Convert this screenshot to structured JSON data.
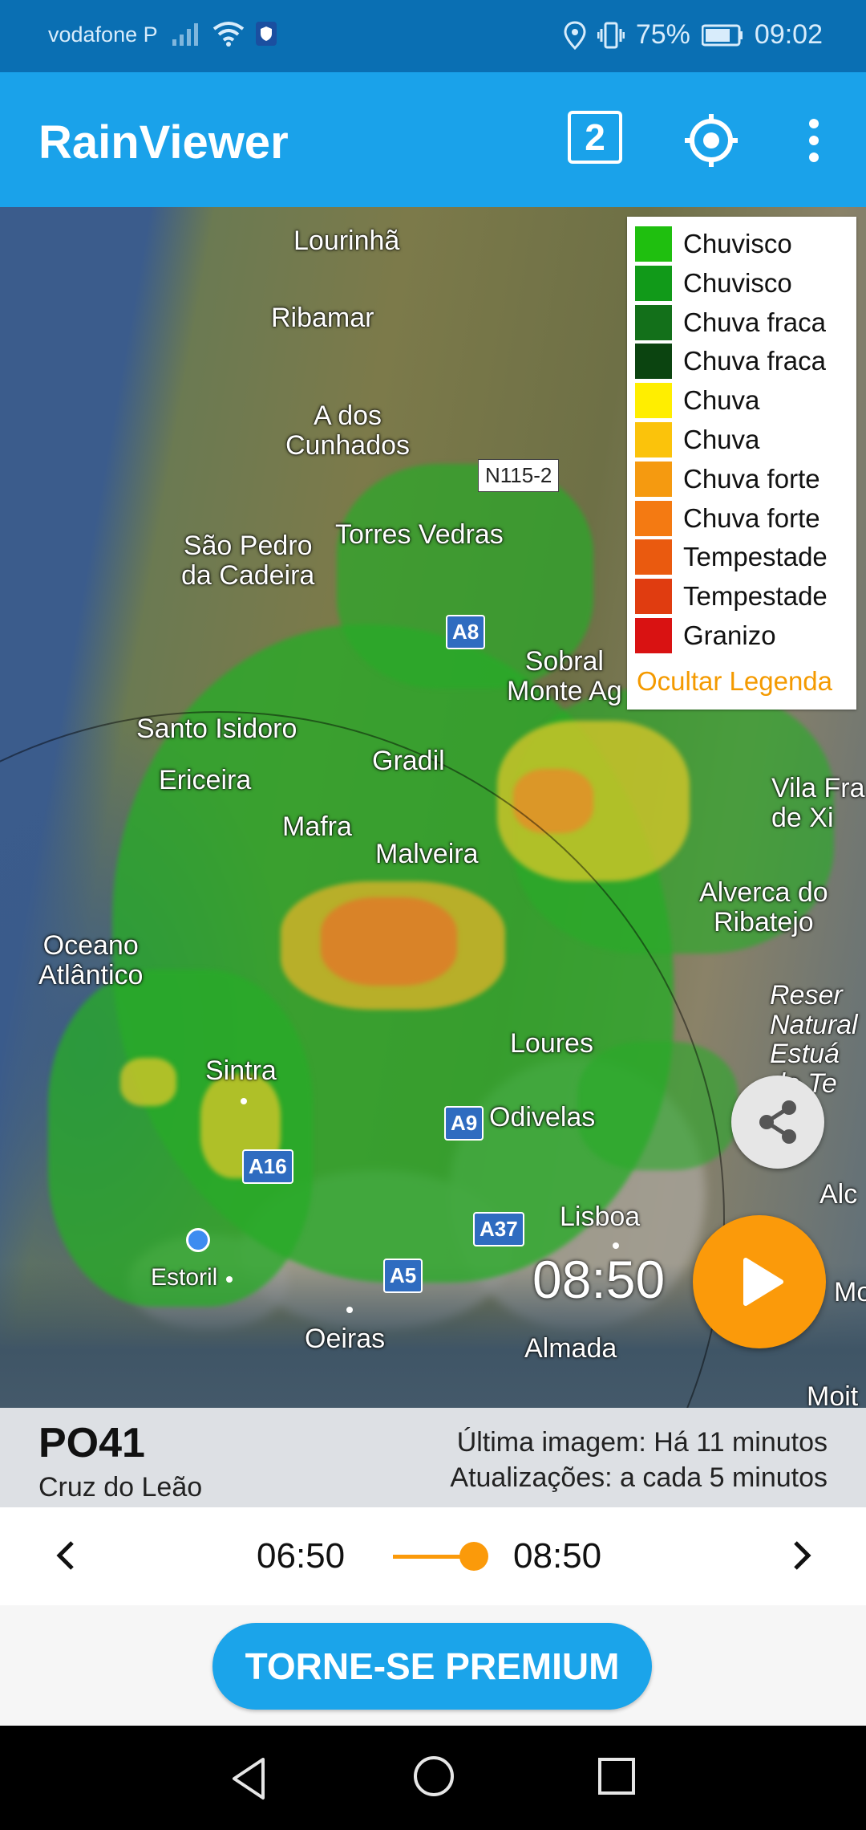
{
  "status_bar": {
    "carrier": "vodafone P",
    "battery": "75%",
    "time": "09:02",
    "icons": [
      "signal-icon",
      "wifi-icon",
      "shield-icon",
      "location-icon",
      "vibrate-icon",
      "battery-icon"
    ]
  },
  "app_bar": {
    "title": "RainViewer",
    "radar_count": "2",
    "icons": [
      "locate-icon",
      "more-vert-icon"
    ]
  },
  "legend": {
    "items": [
      {
        "label": "Chuvisco",
        "color": "#1fbf0f"
      },
      {
        "label": "Chuvisco",
        "color": "#119a19"
      },
      {
        "label": "Chuva fraca",
        "color": "#13701a"
      },
      {
        "label": "Chuva fraca",
        "color": "#0b4410"
      },
      {
        "label": "Chuva",
        "color": "#ffee00"
      },
      {
        "label": "Chuva",
        "color": "#fbc30b"
      },
      {
        "label": "Chuva forte",
        "color": "#f59a10"
      },
      {
        "label": "Chuva forte",
        "color": "#f47a12"
      },
      {
        "label": "Tempestade",
        "color": "#ea5a0f"
      },
      {
        "label": "Tempestade",
        "color": "#e03c10"
      },
      {
        "label": "Granizo",
        "color": "#d91212"
      }
    ],
    "hide_label": "Ocultar Legenda"
  },
  "map": {
    "labels": {
      "lourinha": "Lourinhã",
      "ribamar": "Ribamar",
      "a_dos_cunhados": "A dos\nCunhados",
      "torres_vedras": "Torres Vedras",
      "sao_pedro": "São Pedro\nda Cadeira",
      "sobral": "Sobral\nMonte Ag",
      "santo_isidoro": "Santo Isidoro",
      "gradil": "Gradil",
      "ericeira": "Ericeira",
      "mafra": "Mafra",
      "malveira": "Malveira",
      "vila_franca": "Vila Fra\nde Xi",
      "alverca": "Alverca do\nRibatejo",
      "oceano": "Oceano\nAtlântico",
      "reserva": "Reser\nNatural\nEstuá\ndo Te",
      "loures": "Loures",
      "sintra": "Sintra",
      "odivelas": "Odivelas",
      "alc": "Alc",
      "lisboa": "Lisboa",
      "estoril": "Estoril",
      "oeiras": "Oeiras",
      "almada": "Almada",
      "mor": "Mor",
      "moit": "Moit"
    },
    "roads": {
      "n115": "N115-2",
      "a8": "A8",
      "a9": "A9",
      "a16": "A16",
      "a37": "A37",
      "a5": "A5"
    },
    "time": "08:50"
  },
  "info": {
    "code": "PO41",
    "name": "Cruz do Leão",
    "last_image": "Última imagem: Há 11 minutos",
    "updates": "Atualizações: a cada 5 minutos"
  },
  "timeline": {
    "start": "06:50",
    "end": "08:50",
    "position": 1.0
  },
  "premium_button": "TORNE-SE PREMIUM",
  "colors": {
    "status_bar": "#0a6fb3",
    "app_bar": "#1aa2ea",
    "accent_orange": "#fb9a0a",
    "premium": "#1ba4ea"
  }
}
